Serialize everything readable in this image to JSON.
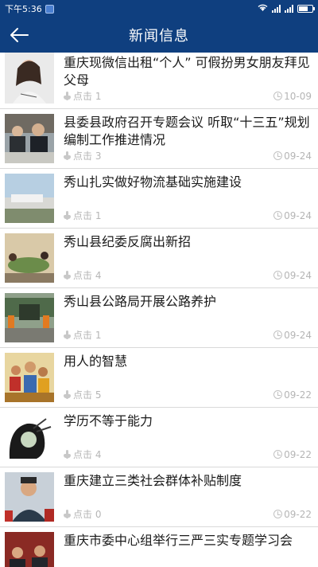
{
  "status_bar": {
    "time": "下午5:36"
  },
  "header": {
    "title": "新闻信息"
  },
  "news": [
    {
      "title": "重庆现微信出租“个人” 可假扮男女朋友拜见父母",
      "click_label": "点击",
      "clicks": "1",
      "date": "10-09"
    },
    {
      "title": "县委县政府召开专题会议 听取“十三五”规划编制工作推进情况",
      "click_label": "点击",
      "clicks": "3",
      "date": "09-24"
    },
    {
      "title": "秀山扎实做好物流基础实施建设",
      "click_label": "点击",
      "clicks": "1",
      "date": "09-24"
    },
    {
      "title": "秀山县纪委反腐出新招",
      "click_label": "点击",
      "clicks": "4",
      "date": "09-24"
    },
    {
      "title": "秀山县公路局开展公路养护",
      "click_label": "点击",
      "clicks": "1",
      "date": "09-24"
    },
    {
      "title": "用人的智慧",
      "click_label": "点击",
      "clicks": "5",
      "date": "09-22"
    },
    {
      "title": "学历不等于能力",
      "click_label": "点击",
      "clicks": "4",
      "date": "09-22"
    },
    {
      "title": "重庆建立三类社会群体补贴制度",
      "click_label": "点击",
      "clicks": "0",
      "date": "09-22"
    },
    {
      "title": "重庆市委中心组举行三严三实专题学习会",
      "click_label": "点击",
      "clicks": "",
      "date": ""
    }
  ]
}
